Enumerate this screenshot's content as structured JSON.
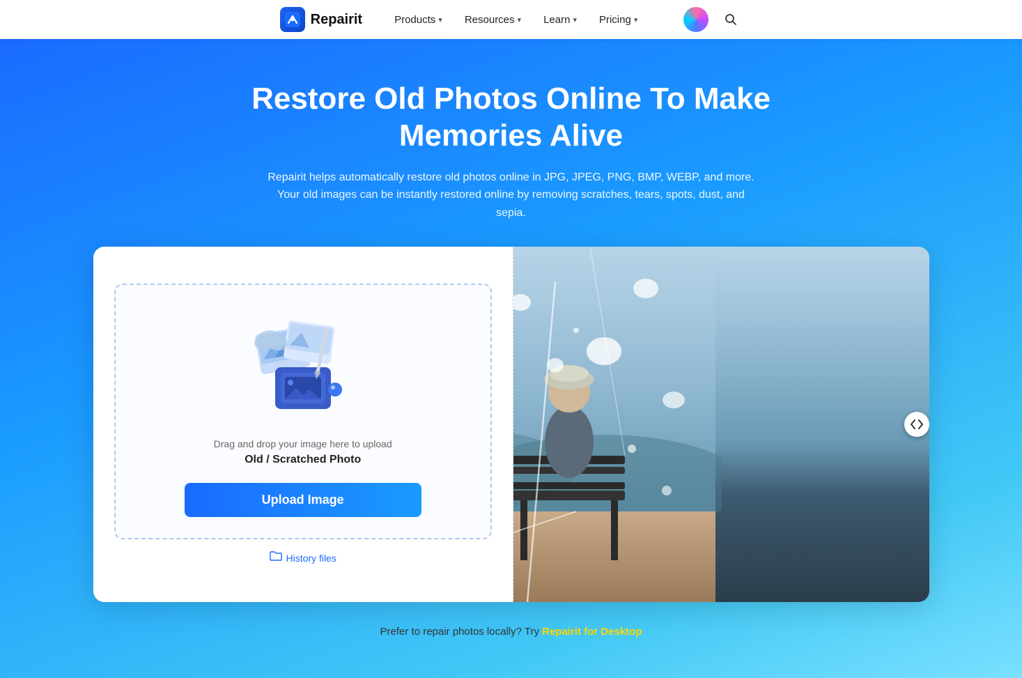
{
  "navbar": {
    "logo_text": "Repairit",
    "logo_icon": "🔧",
    "nav_items": [
      {
        "label": "Products",
        "has_dropdown": true
      },
      {
        "label": "Resources",
        "has_dropdown": true
      },
      {
        "label": "Learn",
        "has_dropdown": true
      },
      {
        "label": "Pricing",
        "has_dropdown": true
      }
    ],
    "search_label": "search",
    "avatar_label": "user avatar"
  },
  "hero": {
    "title": "Restore Old Photos Online To Make Memories Alive",
    "subtitle_line1": "Repairit helps automatically restore old photos online in JPG, JPEG, PNG, BMP, WEBP, and more.",
    "subtitle_line2": "Your old images can be instantly restored online by removing scratches, tears, spots, dust, and sepia."
  },
  "upload_panel": {
    "drag_text": "Drag and drop your image here to upload",
    "photo_type": "Old / Scratched Photo",
    "upload_button": "Upload Image",
    "history_label": "History files"
  },
  "bottom_bar": {
    "text": "Prefer to repair photos locally? Try ",
    "link_text": "Repairit for Desktop",
    "link_url": "#"
  }
}
